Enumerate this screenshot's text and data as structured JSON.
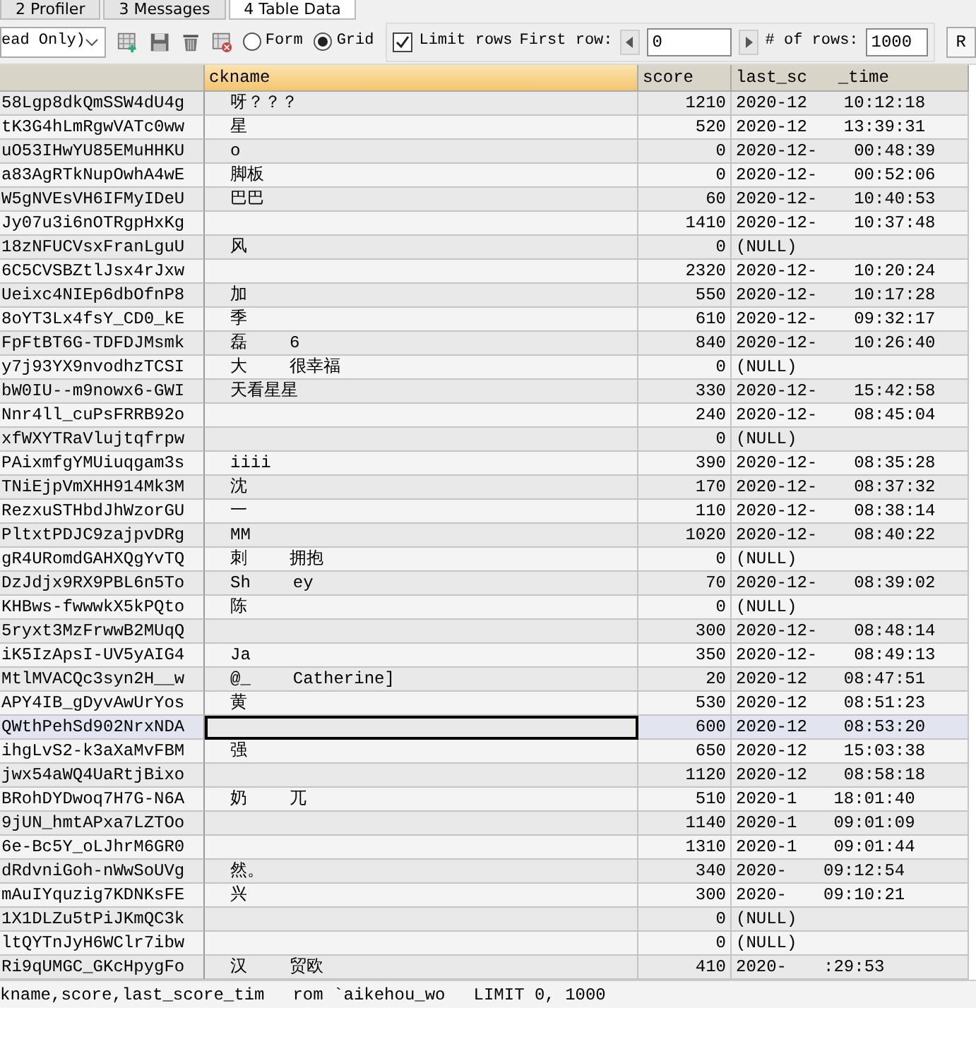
{
  "tabs": [
    {
      "label": "2 Profiler",
      "selected": false
    },
    {
      "label": "3 Messages",
      "selected": false
    },
    {
      "label": "4 Table Data",
      "selected": true
    }
  ],
  "toolbar": {
    "mode_select": "ead Only)",
    "view_options": [
      {
        "label": "Form",
        "selected": false
      },
      {
        "label": "Grid",
        "selected": true
      }
    ],
    "limit_rows": {
      "label": "Limit rows",
      "checked": true
    },
    "first_row_label": "First row:",
    "first_row": "0",
    "rows_label": "# of rows:",
    "rows": "1000",
    "refresh_button": "R"
  },
  "table": {
    "columns": [
      {
        "selected": false
      },
      {
        "label": "ckname",
        "selected": true
      },
      {
        "label": "score",
        "selected": false
      },
      {
        "label": "last_sc",
        "label_end": "_time",
        "selected": false
      }
    ],
    "rows": [
      {
        "id": "58Lgp8dkQmSSW4dU4g",
        "nickname": [
          "呀？？？"
        ],
        "score": "1210",
        "time": [
          "2020-12",
          "10:12:18"
        ],
        "selected": false
      },
      {
        "id": "tK3G4hLmRgwVATc0ww",
        "nickname": [
          "星"
        ],
        "score": "520",
        "time": [
          "2020-12",
          "13:39:31"
        ],
        "selected": false
      },
      {
        "id": "uO53IHwYU85EMuHHKU",
        "nickname": [
          "o"
        ],
        "score": "0",
        "time": [
          "2020-12-",
          "00:48:39"
        ],
        "selected": false
      },
      {
        "id": "a83AgRTkNupOwhA4wE",
        "nickname": [
          "脚板"
        ],
        "score": "0",
        "time": [
          "2020-12-",
          "00:52:06"
        ],
        "selected": false
      },
      {
        "id": "W5gNVEsVH6IFMyIDeU",
        "nickname": [
          "巴巴"
        ],
        "score": "60",
        "time": [
          "2020-12-",
          "10:40:53"
        ],
        "selected": false
      },
      {
        "id": "Jy07u3i6nOTRgpHxKg",
        "nickname": [],
        "score": "1410",
        "time": [
          "2020-12-",
          "10:37:48"
        ],
        "selected": false
      },
      {
        "id": "18zNFUCVsxFranLguU",
        "nickname": [
          "风"
        ],
        "score": "0",
        "time": [
          "(NULL)"
        ],
        "selected": false
      },
      {
        "id": "6C5CVSBZtlJsx4rJxw",
        "nickname": [],
        "score": "2320",
        "time": [
          "2020-12-",
          "10:20:24"
        ],
        "selected": false
      },
      {
        "id": "Ueixc4NIEp6dbOfnP8",
        "nickname": [
          "加"
        ],
        "score": "550",
        "time": [
          "2020-12-",
          "10:17:28"
        ],
        "selected": false
      },
      {
        "id": "8oYT3Lx4fsY_CD0_kE",
        "nickname": [
          "季"
        ],
        "score": "610",
        "time": [
          "2020-12-",
          "09:32:17"
        ],
        "selected": false
      },
      {
        "id": "FpFtBT6G-TDFDJMsmk",
        "nickname": [
          "磊",
          "6"
        ],
        "score": "840",
        "time": [
          "2020-12-",
          "10:26:40"
        ],
        "selected": false
      },
      {
        "id": "y7j93YX9nvodhzTCSI",
        "nickname": [
          "大",
          "很幸福"
        ],
        "score": "0",
        "time": [
          "(NULL)"
        ],
        "selected": false
      },
      {
        "id": "bW0IU--m9nowx6-GWI",
        "nickname": [
          "天看星星"
        ],
        "score": "330",
        "time": [
          "2020-12-",
          "15:42:58"
        ],
        "selected": false
      },
      {
        "id": "Nnr4ll_cuPsFRRB92o",
        "nickname": [],
        "score": "240",
        "time": [
          "2020-12-",
          "08:45:04"
        ],
        "selected": false
      },
      {
        "id": "xfWXYTRaVlujtqfrpw",
        "nickname": [],
        "score": "0",
        "time": [
          "(NULL)"
        ],
        "selected": false
      },
      {
        "id": "PAixmfgYMUiuqgam3s",
        "nickname": [
          "iiii"
        ],
        "score": "390",
        "time": [
          "2020-12-",
          "08:35:28"
        ],
        "selected": false
      },
      {
        "id": "TNiEjpVmXHH914Mk3M",
        "nickname": [
          "沈"
        ],
        "score": "170",
        "time": [
          "2020-12-",
          "08:37:32"
        ],
        "selected": false
      },
      {
        "id": "RezxuSTHbdJhWzorGU",
        "nickname": [
          "一"
        ],
        "score": "110",
        "time": [
          "2020-12-",
          "08:38:14"
        ],
        "selected": false
      },
      {
        "id": "PltxtPDJC9zajpvDRg",
        "nickname": [
          "MM"
        ],
        "score": "1020",
        "time": [
          "2020-12-",
          "08:40:22"
        ],
        "selected": false
      },
      {
        "id": "gR4URomdGAHXQgYvTQ",
        "nickname": [
          "刺",
          "拥抱"
        ],
        "score": "0",
        "time": [
          "(NULL)"
        ],
        "selected": false
      },
      {
        "id": "DzJdjx9RX9PBL6n5To",
        "nickname": [
          "Sh",
          "ey"
        ],
        "score": "70",
        "time": [
          "2020-12-",
          "08:39:02"
        ],
        "selected": false
      },
      {
        "id": "KHBws-fwwwkX5kPQto",
        "nickname": [
          "陈"
        ],
        "score": "0",
        "time": [
          "(NULL)"
        ],
        "selected": false
      },
      {
        "id": "5ryxt3MzFrwwB2MUqQ",
        "nickname": [],
        "score": "300",
        "time": [
          "2020-12-",
          "08:48:14"
        ],
        "selected": false
      },
      {
        "id": "iK5IzApsI-UV5yAIG4",
        "nickname": [
          "Ja"
        ],
        "score": "350",
        "time": [
          "2020-12-",
          "08:49:13"
        ],
        "selected": false
      },
      {
        "id": "MtlMVACQc3syn2H__w",
        "nickname": [
          "@_",
          "Catherine]"
        ],
        "score": "20",
        "time": [
          "2020-12",
          "08:47:51"
        ],
        "selected": false
      },
      {
        "id": "APY4IB_gDyvAwUrYos",
        "nickname": [
          "黄"
        ],
        "score": "530",
        "time": [
          "2020-12",
          "08:51:23"
        ],
        "selected": false
      },
      {
        "id": "QWthPehSd902NrxNDA",
        "nickname": [],
        "score": "600",
        "time": [
          "2020-12",
          "08:53:20"
        ],
        "selected": true
      },
      {
        "id": "ihgLvS2-k3aXaMvFBM",
        "nickname": [
          "强"
        ],
        "score": "650",
        "time": [
          "2020-12",
          "15:03:38"
        ],
        "selected": false
      },
      {
        "id": "jwx54aWQ4UaRtjBixo",
        "nickname": [],
        "score": "1120",
        "time": [
          "2020-12",
          "08:58:18"
        ],
        "selected": false
      },
      {
        "id": "BRohDYDwoq7H7G-N6A",
        "nickname": [
          "奶",
          "兀"
        ],
        "score": "510",
        "time": [
          "2020-1",
          "18:01:40"
        ],
        "selected": false
      },
      {
        "id": "9jUN_hmtAPxa7LZTOo",
        "nickname": [],
        "score": "1140",
        "time": [
          "2020-1",
          "09:01:09"
        ],
        "selected": false
      },
      {
        "id": "6e-Bc5Y_oLJhrM6GR0",
        "nickname": [],
        "score": "1310",
        "time": [
          "2020-1",
          "09:01:44"
        ],
        "selected": false
      },
      {
        "id": "dRdvniGoh-nWwSoUVg",
        "nickname": [
          "然。"
        ],
        "score": "340",
        "time": [
          "2020-",
          "09:12:54"
        ],
        "selected": false
      },
      {
        "id": "mAuIYquzig7KDNKsFE",
        "nickname": [
          "兴"
        ],
        "score": "300",
        "time": [
          "2020-",
          "09:10:21"
        ],
        "selected": false
      },
      {
        "id": "1X1DLZu5tPiJKmQC3k",
        "nickname": [],
        "score": "0",
        "time": [
          "(NULL)"
        ],
        "selected": false
      },
      {
        "id": "ltQYTnJyH6WClr7ibw",
        "nickname": [],
        "score": "0",
        "time": [
          "(NULL)"
        ],
        "selected": false
      },
      {
        "id": "Ri9qUMGC_GKcHpygFo",
        "nickname": [
          "汉",
          "贸欧"
        ],
        "score": "410",
        "time": [
          "2020-",
          ":29:53"
        ],
        "selected": false
      }
    ]
  },
  "status_bar": [
    "kname,score,last_score_tim",
    "rom `aikehou_wo",
    "LIMIT 0, 1000"
  ]
}
